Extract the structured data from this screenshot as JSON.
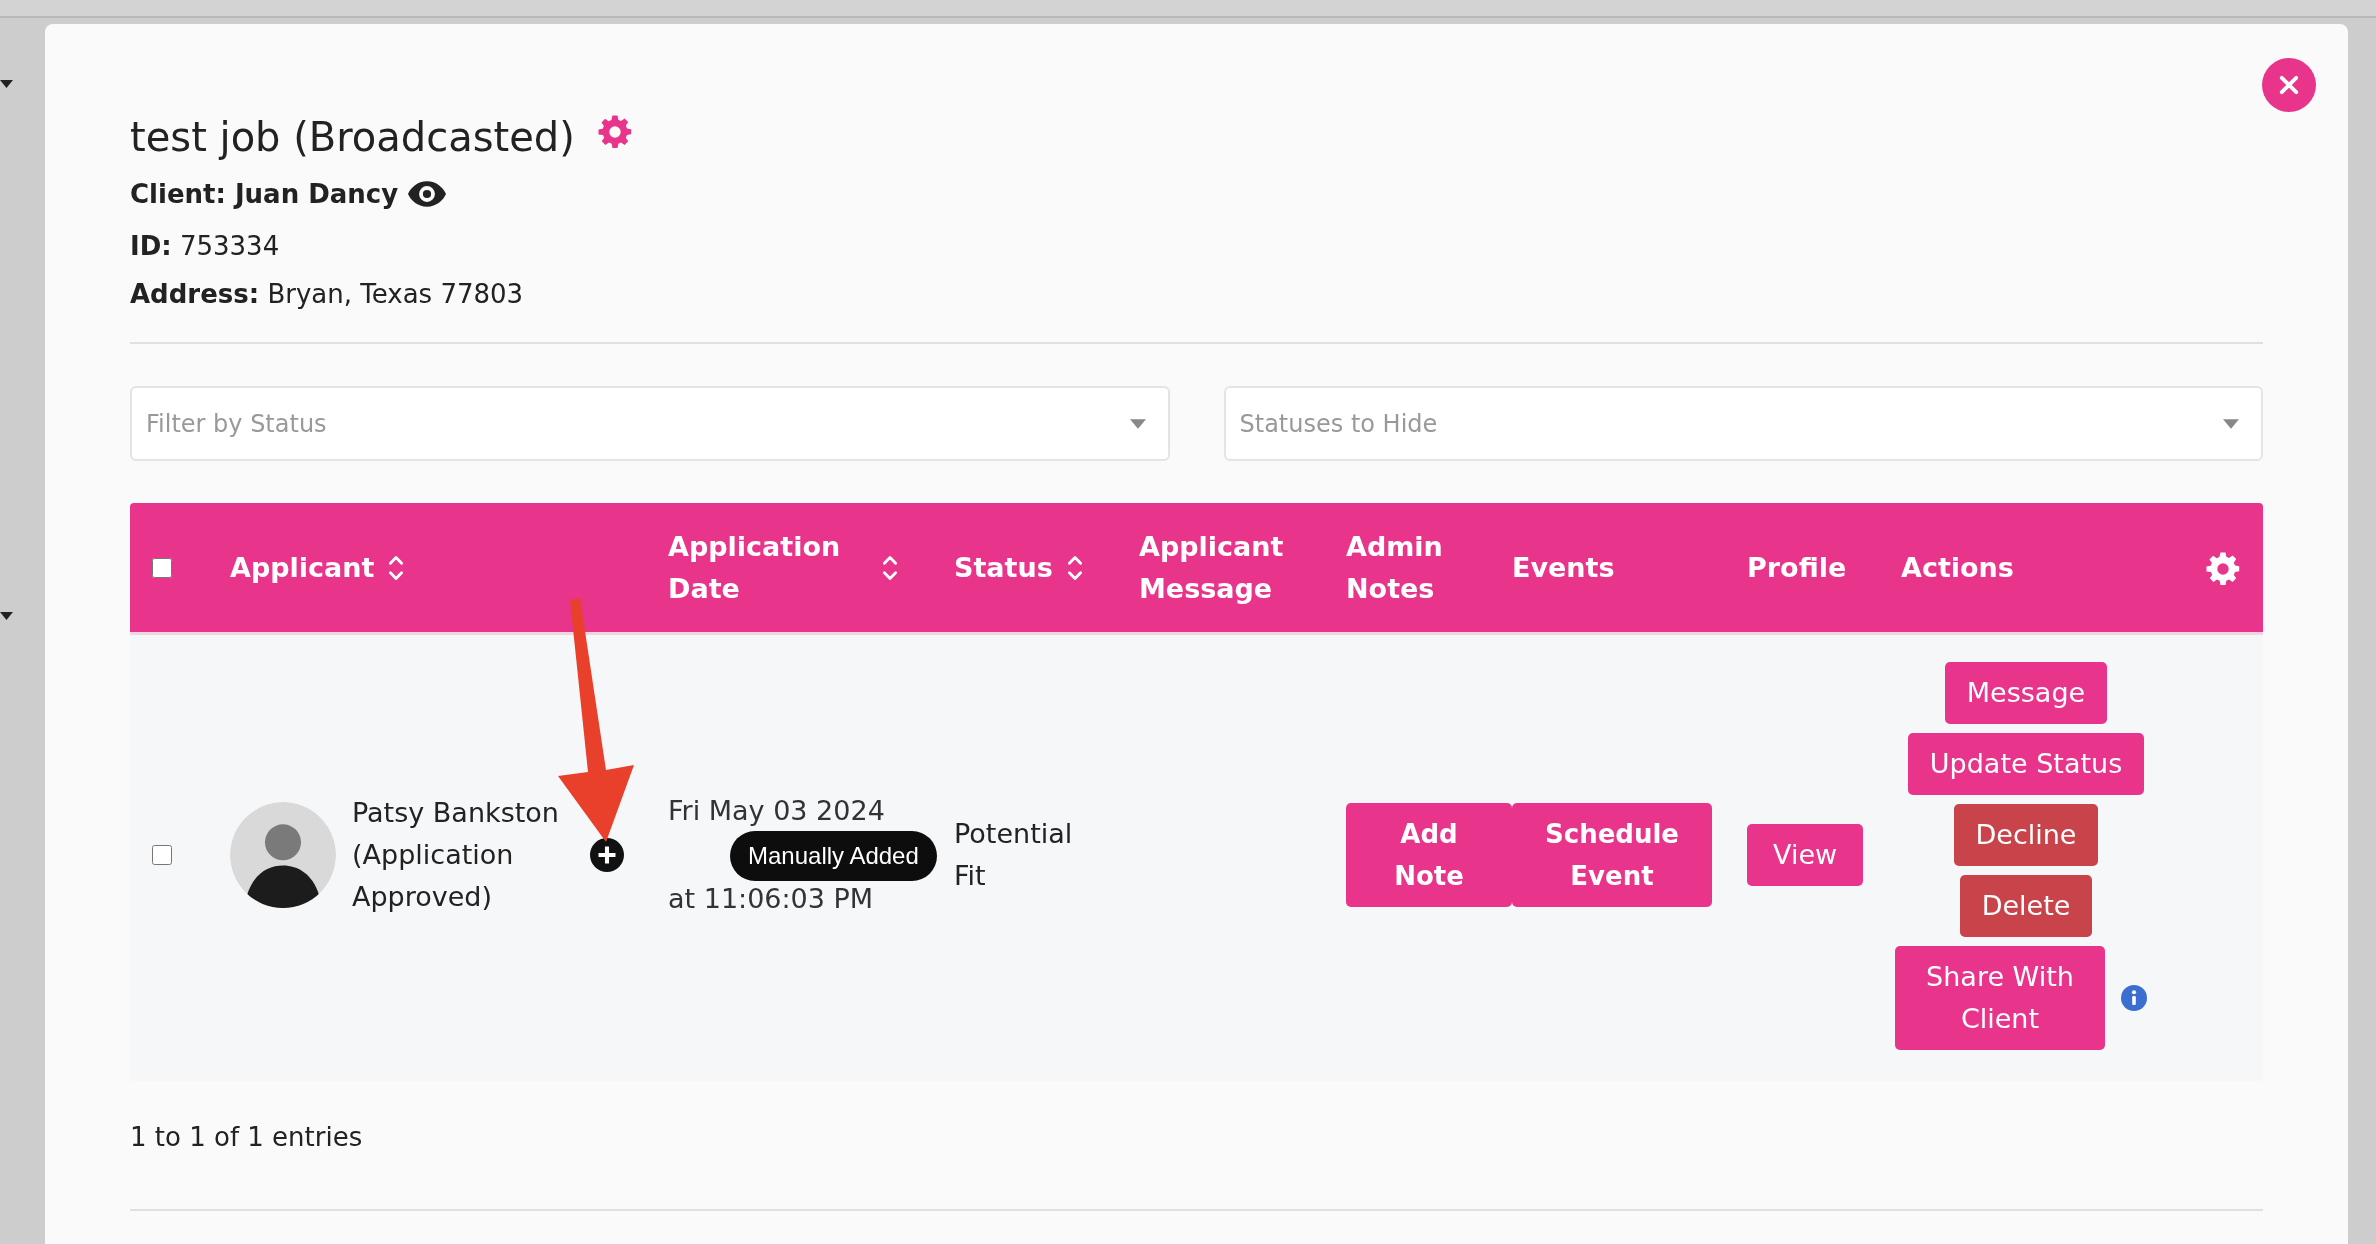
{
  "modal": {
    "title": "test job (Broadcasted)",
    "client": "Client: Juan Dancy",
    "id": "**ID:** 753334",
    "address": "**Address:** Bryan, Texas 77803"
  },
  "filters": [
    {
      "placeholder": "Filter by Status"
    },
    {
      "placeholder": "Statuses to Hide"
    }
  ],
  "table": {
    "all_checked": false,
    "columns": [
      {
        "label": "Applicant",
        "sortable": true
      },
      {
        "label": "Application Date",
        "sortable": true
      },
      {
        "label": "Status",
        "sortable": true
      },
      {
        "label": "Applicant Message",
        "sortable": false
      },
      {
        "label": "Admin Notes",
        "sortable": false
      },
      {
        "label": "Events",
        "sortable": false
      },
      {
        "label": "Profile",
        "sortable": false
      },
      {
        "label": "Actions",
        "sortable": false
      }
    ],
    "rows": [
      {
        "checked": false,
        "applicant": "Patsy Bankston (Application Approved)",
        "manually_added": true,
        "tooltip": "Manually Added",
        "date": "Fri May 03 2024",
        "time": "at 11:06:03 PM",
        "status": "Potential Fit",
        "notes_button": "Add Note",
        "events_button": "Schedule Event",
        "profile_button": "View",
        "actions": [
          {
            "label": "Message",
            "kind": "primary"
          },
          {
            "label": "Update Status",
            "kind": "primary"
          },
          {
            "label": "Decline",
            "kind": "danger"
          },
          {
            "label": "Delete",
            "kind": "danger"
          },
          {
            "label": "Share With Client",
            "kind": "info"
          }
        ]
      }
    ]
  },
  "footer": {
    "entries": "1 to 1 of 1 entries"
  }
}
